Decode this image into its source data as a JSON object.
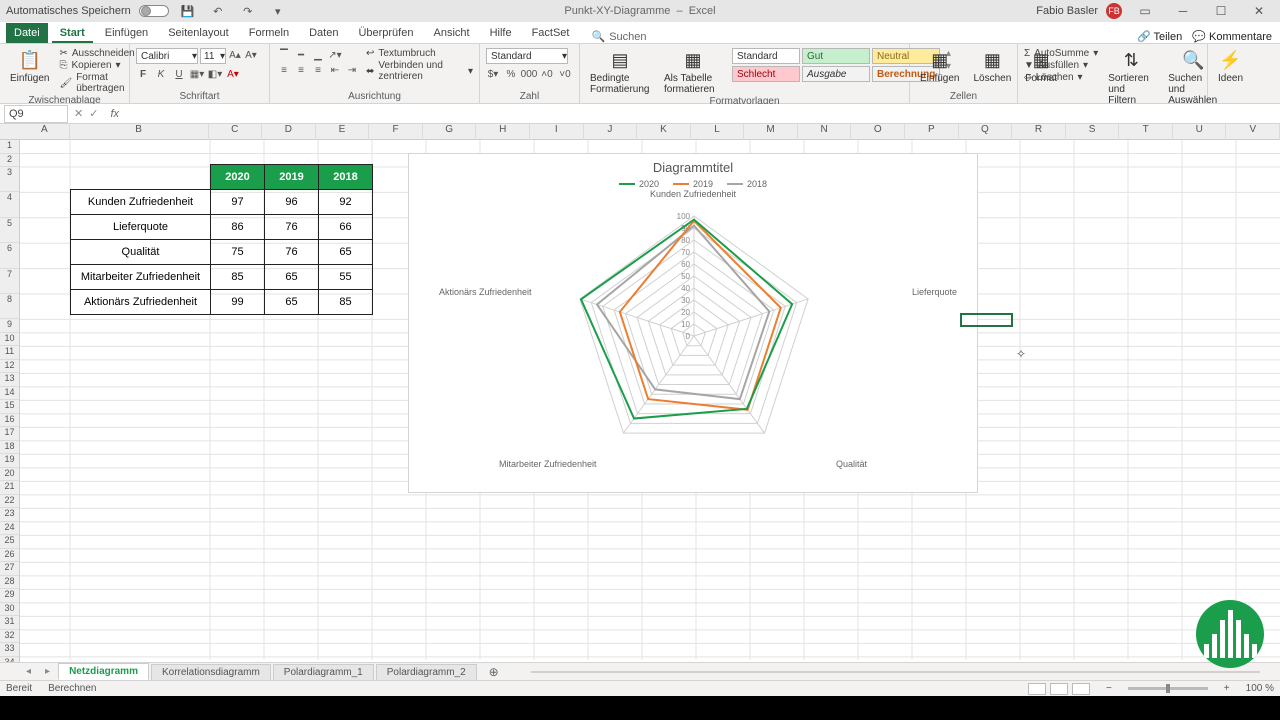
{
  "titlebar": {
    "autosave": "Automatisches Speichern",
    "doc_name": "Punkt-XY-Diagramme",
    "app_name": "Excel",
    "user": "Fabio Basler",
    "initials": "FB"
  },
  "tabs": {
    "file": "Datei",
    "start": "Start",
    "einfuegen": "Einfügen",
    "seitenlayout": "Seitenlayout",
    "formeln": "Formeln",
    "daten": "Daten",
    "ueberpruefen": "Überprüfen",
    "ansicht": "Ansicht",
    "hilfe": "Hilfe",
    "factset": "FactSet",
    "search": "Suchen",
    "share": "Teilen",
    "comments": "Kommentare"
  },
  "ribbon": {
    "paste": "Einfügen",
    "cut": "Ausschneiden",
    "copy": "Kopieren",
    "format_painter": "Format übertragen",
    "clipboard": "Zwischenablage",
    "font_name": "Calibri",
    "font_size": "11",
    "font_group": "Schriftart",
    "wrap": "Textumbruch",
    "merge": "Verbinden und zentrieren",
    "align_group": "Ausrichtung",
    "num_format": "Standard",
    "num_group": "Zahl",
    "cond_fmt": "Bedingte Formatierung",
    "as_table": "Als Tabelle formatieren",
    "style_standard": "Standard",
    "style_gut": "Gut",
    "style_neutral": "Neutral",
    "style_schlecht": "Schlecht",
    "style_ausgabe": "Ausgabe",
    "style_berechnung": "Berechnung",
    "styles_group": "Formatvorlagen",
    "insert_cells": "Einfügen",
    "delete_cells": "Löschen",
    "format_cells": "Format",
    "cells_group": "Zellen",
    "autosum": "AutoSumme",
    "fill": "Ausfüllen",
    "clear": "Löschen",
    "sort": "Sortieren und Filtern",
    "find": "Suchen und Auswählen",
    "edit_group": "Bearbeiten",
    "ideas": "Ideen"
  },
  "namebox": "Q9",
  "chart_data": {
    "type": "radar",
    "title": "Diagrammtitel",
    "categories": [
      "Kunden Zufriedenheit",
      "Lieferquote",
      "Qualität",
      "Mitarbeiter Zufriedenheit",
      "Aktionärs Zufriedenheit"
    ],
    "series": [
      {
        "name": "2020",
        "color": "#1b9e4b",
        "values": [
          97,
          86,
          75,
          85,
          99
        ]
      },
      {
        "name": "2019",
        "color": "#ed7d31",
        "values": [
          96,
          76,
          76,
          65,
          65
        ]
      },
      {
        "name": "2018",
        "color": "#a6a6a6",
        "values": [
          92,
          66,
          65,
          55,
          85
        ]
      }
    ],
    "ticks": [
      0,
      10,
      20,
      30,
      40,
      50,
      60,
      70,
      80,
      90,
      100
    ],
    "rmax": 100
  },
  "table": {
    "headers": [
      "2020",
      "2019",
      "2018"
    ],
    "rows": [
      {
        "label": "Kunden Zufriedenheit",
        "v": [
          "97",
          "96",
          "92"
        ]
      },
      {
        "label": "Lieferquote",
        "v": [
          "86",
          "76",
          "66"
        ]
      },
      {
        "label": "Qualität",
        "v": [
          "75",
          "76",
          "65"
        ]
      },
      {
        "label": "Mitarbeiter Zufriedenheit",
        "v": [
          "85",
          "65",
          "55"
        ]
      },
      {
        "label": "Aktionärs Zufriedenheit",
        "v": [
          "99",
          "65",
          "85"
        ]
      }
    ]
  },
  "sheets": {
    "s1": "Netzdiagramm",
    "s2": "Korrelationsdiagramm",
    "s3": "Polardiagramm_1",
    "s4": "Polardiagramm_2"
  },
  "status": {
    "ready": "Bereit",
    "calc": "Berechnen",
    "zoom": "100 %"
  },
  "columns": [
    "A",
    "B",
    "C",
    "D",
    "E",
    "F",
    "G",
    "H",
    "I",
    "J",
    "K",
    "L",
    "M",
    "N",
    "O",
    "P",
    "Q",
    "R",
    "S",
    "T",
    "U",
    "V"
  ]
}
